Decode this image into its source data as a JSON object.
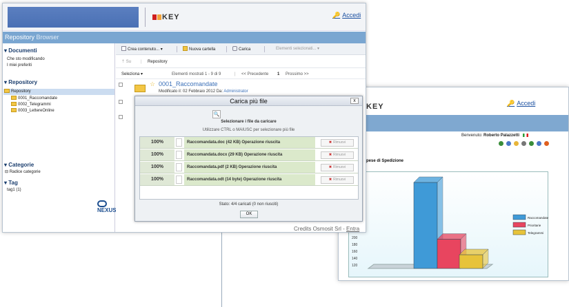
{
  "header": {
    "logo_text": "KEY",
    "login_link": "Accedi"
  },
  "title_bar": {
    "title": "Repository",
    "subtitle": "Browser"
  },
  "sidebar": {
    "documents_title": "Documenti",
    "documents_items": [
      "Che sto modificando",
      "I miei preferiti"
    ],
    "repository_title": "Repository",
    "repository_root": "Repository",
    "repository_children": [
      "0001_Raccomandate",
      "0002_Telegrammi",
      "0003_LettereOnline"
    ],
    "categories_title": "Categorie",
    "categories_root": "Radice categorie",
    "tag_title": "Tag",
    "tag_items": [
      "tag1 (1)"
    ],
    "footer_logo": "NEXUS"
  },
  "toolbar": {
    "create_label": "Crea contenuto...",
    "new_folder_label": "Nuova cartella",
    "upload_label": "Carica",
    "selected_label": "Elementi selezionati..."
  },
  "nav": {
    "up_label": "Su",
    "path": "Repository"
  },
  "listing": {
    "select_label": "Seleziona",
    "shown_label": "Elementi mostrati 1 - 9 di 9",
    "prev_label": "<< Precedente",
    "page": "1",
    "next_label": "Prossimo >>",
    "item_name": "0001_Raccomandate",
    "modified_prefix": "Modificato il: 02 Febbraio 2012  Da:",
    "modified_by": "Administrator"
  },
  "credits": {
    "text": "Credits Osmosit Srl",
    "separator": "-",
    "enter_link": "Entra"
  },
  "dialog": {
    "title": "Carica più file",
    "close": "x",
    "select_files": "Selezionare i file da caricare",
    "hint": "Utilizzare CTRL o MAIUSC per selezionare più file",
    "rows": [
      {
        "percent": "100%",
        "file": "Raccomandata.doc (42 KB) Operazione riuscita",
        "remove": "Rimuovi"
      },
      {
        "percent": "100%",
        "file": "Raccomandata.docx (29 KB) Operazione riuscita",
        "remove": "Rimuovi"
      },
      {
        "percent": "100%",
        "file": "Raccomandata.pdf (2 KB) Operazione riuscita",
        "remove": "Rimuovi"
      },
      {
        "percent": "100%",
        "file": "Raccomandata.odt (14 byte) Operazione riuscita",
        "remove": "Rimuovi"
      }
    ],
    "status": "Stato: 4/4 caricati (0 non riusciti)",
    "ok_label": "OK"
  },
  "back_window": {
    "logo_text": "KEY",
    "login_link": "Accedi",
    "welcome_prefix": "Benvenuto:",
    "user_name": "Roberto Palazzetti",
    "chart_title": "pese di Spedizione"
  },
  "chart_data": {
    "type": "bar",
    "title": "",
    "categories": [
      "Raccomandate",
      "Prioritarie",
      "Telegrammi"
    ],
    "values": [
      360,
      195,
      150
    ],
    "colors": [
      "#3f9ad7",
      "#e8455f",
      "#e7c33a"
    ],
    "y_ticks": [
      120,
      140,
      160,
      180,
      200,
      220
    ],
    "ylim": [
      110,
      370
    ],
    "legend": [
      "Raccomandate",
      "Prioritarie",
      "Telegrammi"
    ],
    "legend_position": "right"
  }
}
